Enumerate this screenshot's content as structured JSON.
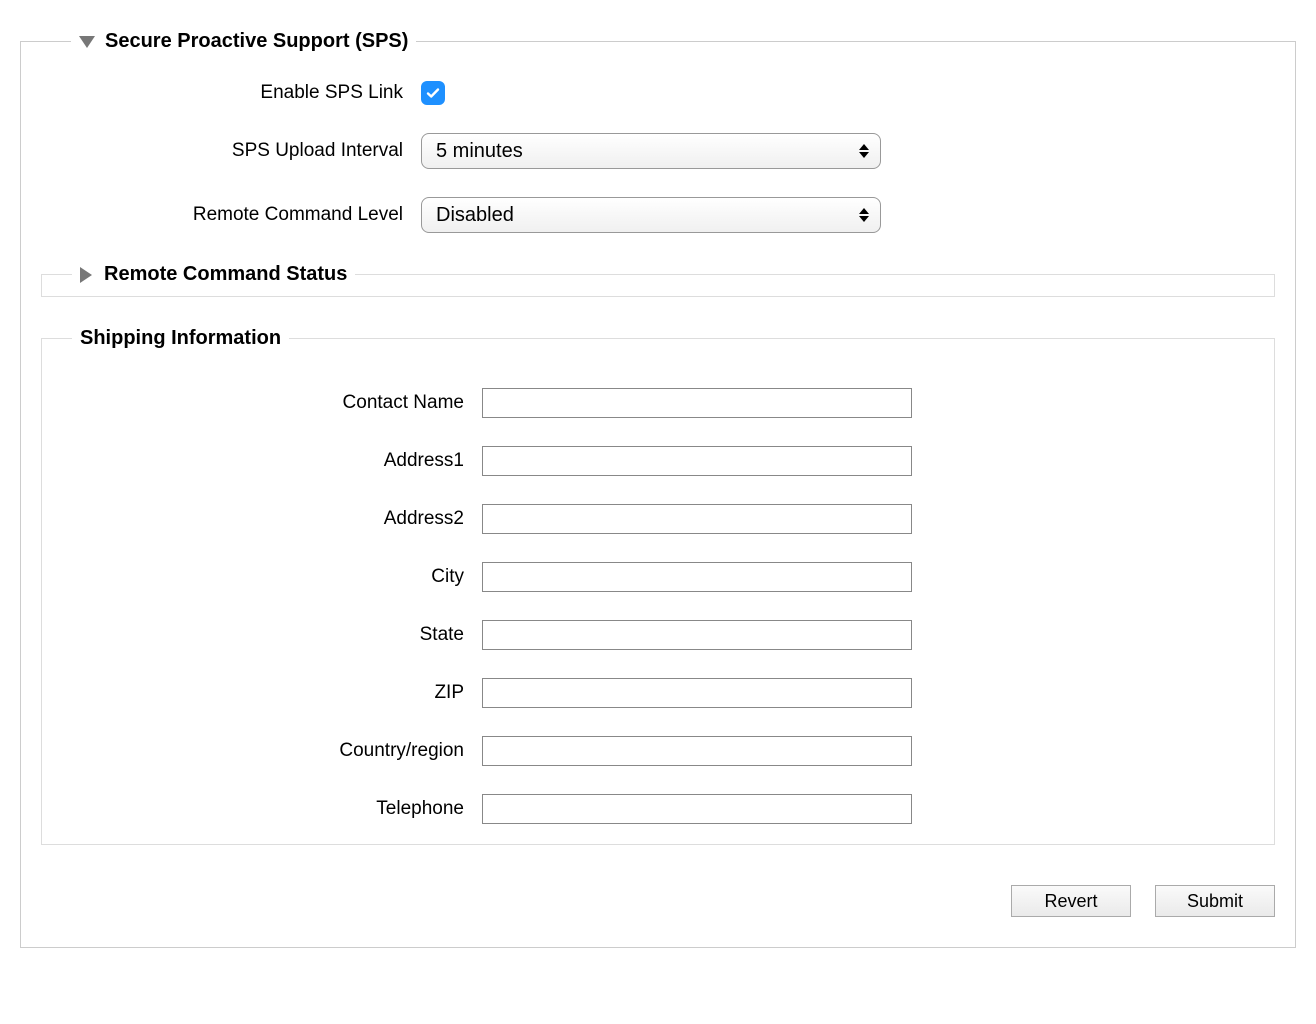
{
  "sps": {
    "section_title": "Secure Proactive Support (SPS)",
    "enable_label": "Enable SPS Link",
    "enable_checked": true,
    "upload_label": "SPS Upload Interval",
    "upload_value": "5 minutes",
    "remote_level_label": "Remote Command Level",
    "remote_level_value": "Disabled",
    "remote_status_title": "Remote Command Status"
  },
  "shipping": {
    "section_title": "Shipping Information",
    "fields": {
      "contact_name": {
        "label": "Contact Name",
        "value": ""
      },
      "address1": {
        "label": "Address1",
        "value": ""
      },
      "address2": {
        "label": "Address2",
        "value": ""
      },
      "city": {
        "label": "City",
        "value": ""
      },
      "state": {
        "label": "State",
        "value": ""
      },
      "zip": {
        "label": "ZIP",
        "value": ""
      },
      "country": {
        "label": "Country/region",
        "value": ""
      },
      "telephone": {
        "label": "Telephone",
        "value": ""
      }
    }
  },
  "buttons": {
    "revert": "Revert",
    "submit": "Submit"
  }
}
